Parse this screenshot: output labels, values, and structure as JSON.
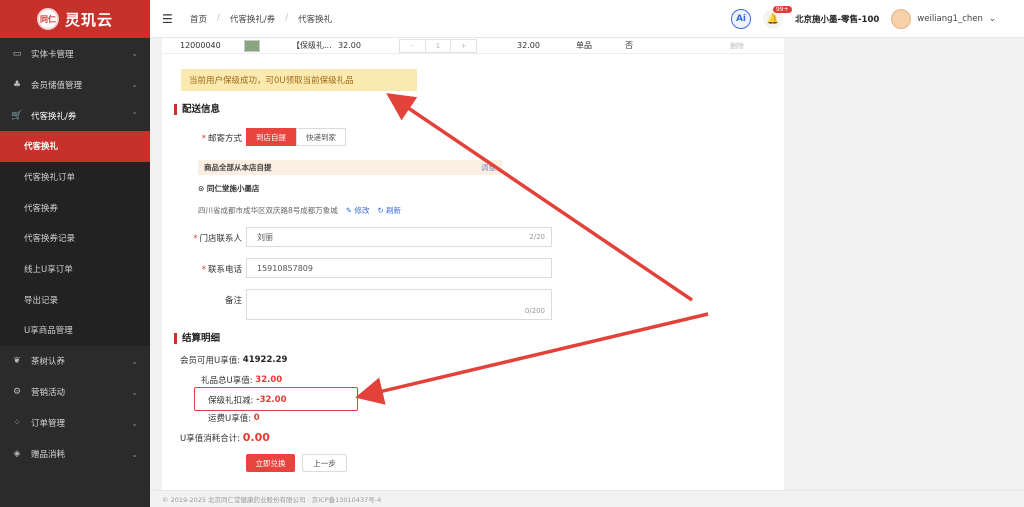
{
  "logo": {
    "mark": "同仁",
    "text": "灵玑云"
  },
  "sidebar": {
    "items": [
      {
        "icon": "card-icon",
        "glyph": "▭",
        "label": "实体卡管理",
        "chevron": "⌄"
      },
      {
        "icon": "users-icon",
        "glyph": "♣",
        "label": "会员储值管理",
        "chevron": "⌄"
      },
      {
        "icon": "cart-icon",
        "glyph": "🛒",
        "label": "代客换礼/券",
        "chevron": "⌃"
      }
    ],
    "sub": [
      {
        "label": "代客换礼",
        "active": true
      },
      {
        "label": "代客换礼订单"
      },
      {
        "label": "代客换券"
      },
      {
        "label": "代客换券记录"
      },
      {
        "label": "线上U享订单"
      },
      {
        "label": "导出记录"
      },
      {
        "label": "U享商品管理"
      }
    ],
    "more": [
      {
        "icon": "tea-icon",
        "glyph": "❦",
        "label": "茶树认养",
        "chevron": "⌄"
      },
      {
        "icon": "marketing-icon",
        "glyph": "⚙",
        "label": "营销活动",
        "chevron": "⌄"
      },
      {
        "icon": "orders-icon",
        "glyph": "⁘",
        "label": "订单管理",
        "chevron": "⌄"
      },
      {
        "icon": "gift-icon",
        "glyph": "◈",
        "label": "赠品消耗",
        "chevron": "⌄"
      }
    ]
  },
  "header": {
    "menu_glyph": "☰",
    "breadcrumb": [
      "首页",
      "代客换礼/券",
      "代客换礼"
    ],
    "sep": "/",
    "ai": "Ai",
    "bell_badge": "99+",
    "store": "北京施小墨-零售-100",
    "user": "weiliang1_chen",
    "user_chevron": "⌄"
  },
  "product_row": {
    "code": "12000040",
    "name": "【保级礼...",
    "price": "32.00",
    "qty": "1",
    "subtotal": "32.00",
    "type": "单品",
    "flag": "否",
    "action": "删除"
  },
  "notice": "当前用户保级成功，可0U领取当前保级礼品",
  "delivery": {
    "title": "配送信息",
    "method_label": "邮寄方式",
    "options": [
      "到店自提",
      "快递到家"
    ],
    "pickup_note": "商品全部从本店自提",
    "pickup_tail": "调整",
    "shop": "同仁堂施小墨店",
    "address": "四川省成都市成华区双庆路8号成都万象城",
    "edit": "修改",
    "refresh": "刷新",
    "contact_label": "门店联系人",
    "contact_value": "刘丽",
    "contact_count": "2/20",
    "phone_label": "联系电话",
    "phone_value": "15910857809",
    "remark_label": "备注",
    "remark_count": "0/200"
  },
  "settlement": {
    "title": "结算明细",
    "available_label": "会员可用U享值:",
    "available_value": "41922.29",
    "gift_total_label": "礼品总U享值:",
    "gift_total_value": "32.00",
    "deduct_label": "保级礼扣减:",
    "deduct_value": "-32.00",
    "shipping_label": "运费U享值:",
    "shipping_value": "0",
    "total_label": "U享值消耗合计:",
    "total_value": "0.00",
    "submit": "立即兑换",
    "back": "上一步"
  },
  "footer": "© 2019-2025 北京同仁堂健康药业股份有限公司 · 京ICP备13010437号-4",
  "colors": {
    "brand": "#c8302b",
    "primary": "#e8433d",
    "annotation": "#e2423a"
  }
}
